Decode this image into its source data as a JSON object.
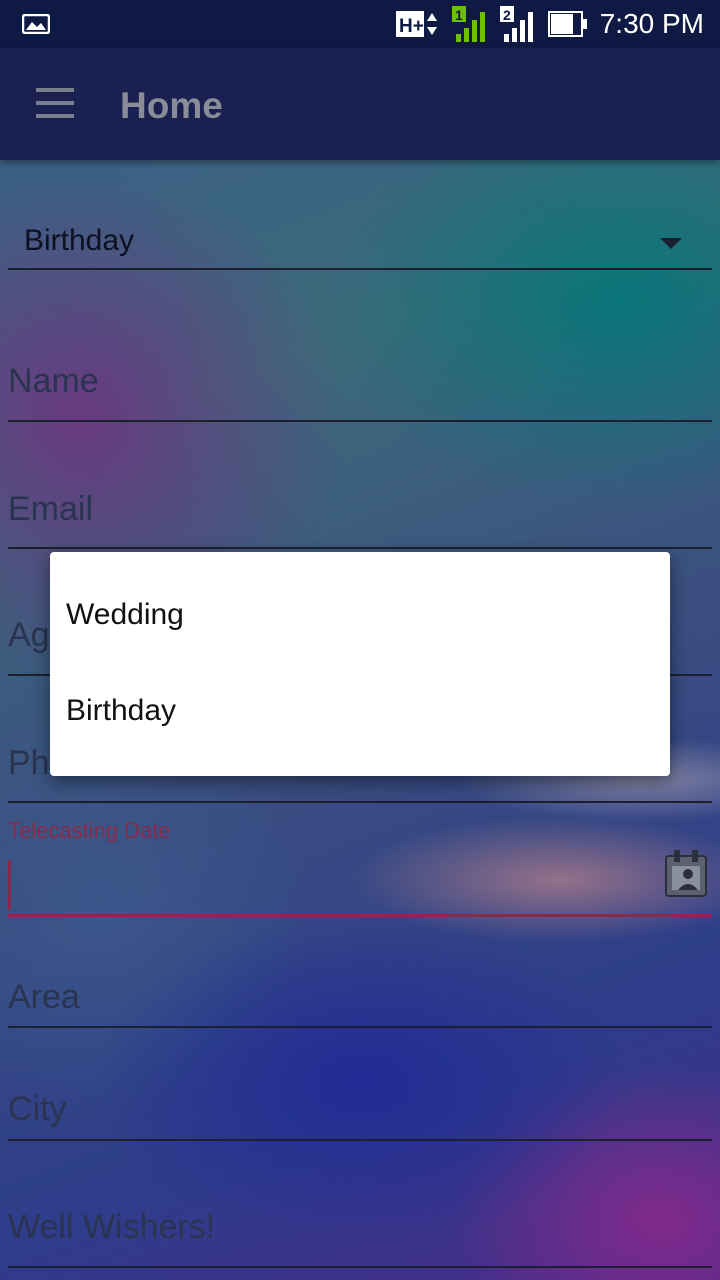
{
  "status_bar": {
    "time": "7:30 PM",
    "network_label": "H+",
    "sim1": "1",
    "sim2": "2",
    "icons": [
      "image-notification-icon",
      "network-arrows-icon",
      "signal-sim1-icon",
      "signal-sim2-icon",
      "battery-icon"
    ],
    "colors": {
      "sim1_accent": "#6cc000"
    }
  },
  "app_bar": {
    "title": "Home",
    "menu_icon": "hamburger-menu-icon"
  },
  "form": {
    "event_type": "Birthday",
    "name_placeholder": "Name",
    "email_placeholder": "Email",
    "age_placeholder": "Age",
    "phone_placeholder": "Phone",
    "telecasting_date_label": "Telecasting Date",
    "area_placeholder": "Area",
    "city_placeholder": "City",
    "well_wishers_placeholder": "Well Wishers!",
    "calendar_icon": "calendar-icon"
  },
  "dropdown": {
    "options": [
      "Wedding",
      "Birthday"
    ]
  },
  "colors": {
    "accent_error": "#8a2a4a",
    "app_bar": "#1a2150",
    "status_bar": "#0f1a44"
  }
}
